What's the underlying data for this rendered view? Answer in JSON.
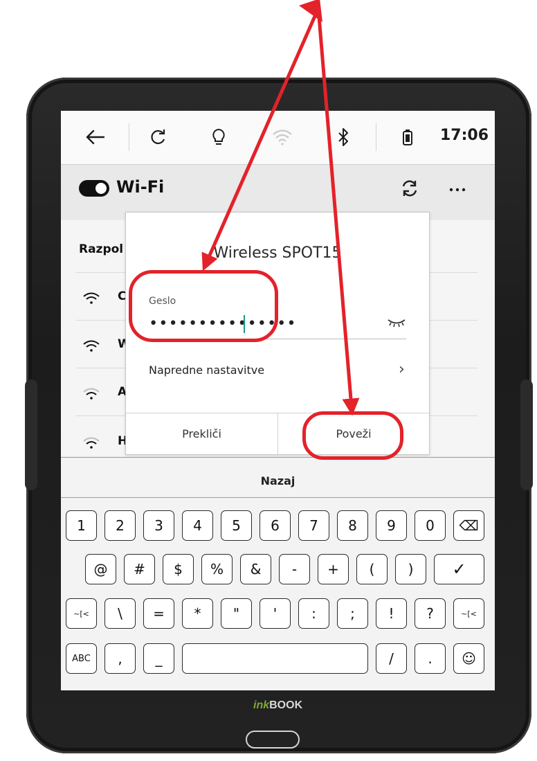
{
  "status_bar": {
    "time": "17:06",
    "icons": [
      "back-arrow-icon",
      "refresh-icon",
      "lightbulb-icon",
      "wifi-icon",
      "bluetooth-icon",
      "battery-icon"
    ]
  },
  "wifi_header": {
    "title": "Wi-Fi",
    "toggle_on": true,
    "icons": [
      "sync-icon",
      "more-icon"
    ]
  },
  "list": {
    "section_label": "Razpol",
    "rows": [
      {
        "initial": "C"
      },
      {
        "initial": "W"
      },
      {
        "initial": "A"
      },
      {
        "initial": "H"
      }
    ]
  },
  "dialog": {
    "title": "Wireless SPOT15",
    "password_label": "Geslo",
    "password_value": "•••••••••••••••",
    "advanced_label": "Napredne nastavitve",
    "advanced_chevron": "›",
    "cancel_label": "Prekliči",
    "connect_label": "Poveži"
  },
  "keyboard": {
    "back_label": "Nazaj",
    "row1": [
      "1",
      "2",
      "3",
      "4",
      "5",
      "6",
      "7",
      "8",
      "9",
      "0",
      "⌫"
    ],
    "row2": [
      "@",
      "#",
      "$",
      "%",
      "&",
      "-",
      "+",
      "(",
      ")",
      "✓"
    ],
    "row3": [
      "~[<",
      "\\",
      "=",
      "*",
      "\"",
      "'",
      ":",
      ";",
      "!",
      "?",
      "~[<"
    ],
    "row4": [
      "ABC",
      ",",
      "_",
      "",
      "/",
      ".",
      "☺"
    ]
  },
  "device": {
    "brand_prefix": "ink",
    "brand": "BOOK"
  },
  "colors": {
    "annotation": "#e3222a",
    "cursor": "#1a9a8a"
  }
}
